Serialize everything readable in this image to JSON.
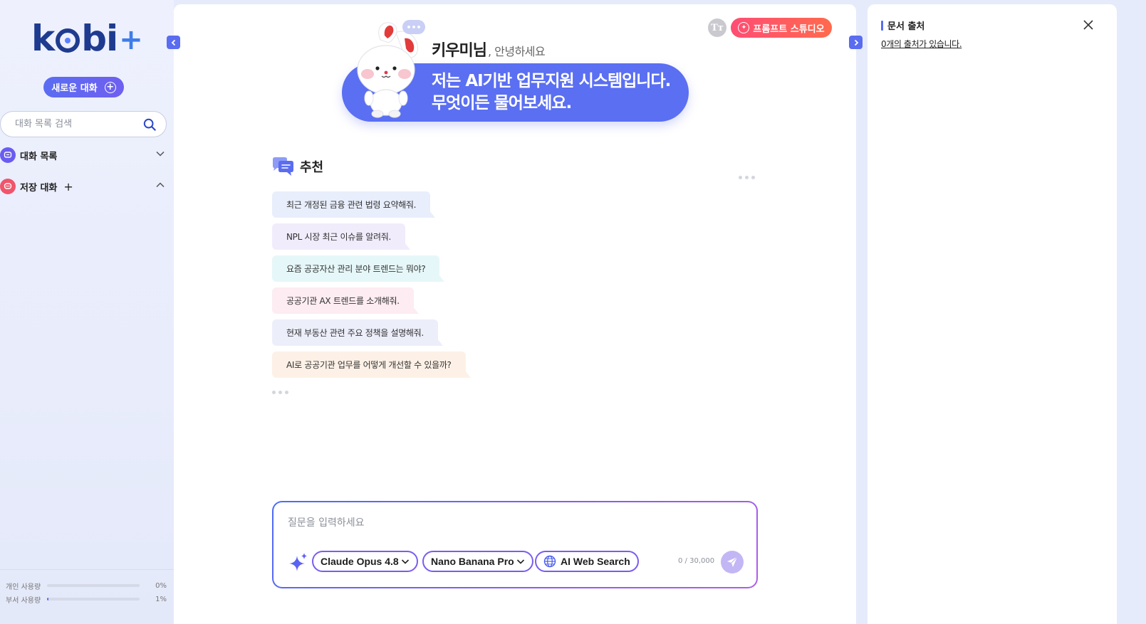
{
  "sidebar": {
    "logo": {
      "text_left": "k",
      "text_right": "bi",
      "plus": "+"
    },
    "new_chat_label": "새로운 대화",
    "search": {
      "placeholder": "대화 목록 검색",
      "value": ""
    },
    "sections": [
      {
        "label": "대화 목록",
        "icon": "chat-list-icon",
        "color": "#6a5cf0",
        "expanded": false
      },
      {
        "label": "저장 대화",
        "icon": "saved-chat-icon",
        "color": "#f0556b",
        "expanded": true,
        "add": "+"
      }
    ],
    "usage": [
      {
        "label": "개인 사용량",
        "percent_text": "0%",
        "fraction": 0.0
      },
      {
        "label": "부서 사용량",
        "percent_text": "1%",
        "fraction": 0.01
      }
    ]
  },
  "main": {
    "font_toggle_label": "Tт",
    "prompt_studio_label": "프롬프트 스튜디오",
    "greeting_name": "키우미님",
    "greeting_text": ", 안녕하세요",
    "hero_line1": "저는 AI기반 업무지원 시스템입니다.",
    "hero_line2": "무엇이든 물어보세요.",
    "typing_bubble": "•••",
    "recommend_title": "추천",
    "recommendations": [
      {
        "text": "최근 개정된 금융 관련 법령 요약해줘.",
        "bg": "#e8eefb",
        "tail": "#e8eefb"
      },
      {
        "text": "NPL 시장 최근 이슈를 알려줘.",
        "bg": "#f1ecfb",
        "tail": "#f1ecfb"
      },
      {
        "text": "요즘 공공자산 관리 분야 트렌드는 뭐야?",
        "bg": "#e6f7f9",
        "tail": "#e6f7f9"
      },
      {
        "text": "공공기관 AX 트렌드를 소개해줘.",
        "bg": "#fdecf2",
        "tail": "#fdecf2"
      },
      {
        "text": "현재 부동산 관련 주요 정책을 설명해줘.",
        "bg": "#eceefa",
        "tail": "#eceefa"
      },
      {
        "text": "AI로 공공기관 업무를 어떻게 개선할 수 있을까?",
        "bg": "#fdf1e7",
        "tail": "#fdf1e7"
      }
    ],
    "input": {
      "placeholder": "질문을 입력하세요",
      "value": "",
      "char_count": "0 / 30,000",
      "model_label": "Claude Opus 4.8",
      "image_model_label": "Nano Banana Pro",
      "web_search_label": "AI Web Search"
    }
  },
  "right_panel": {
    "title": "문서 출처",
    "sources_text": "0개의 출처가 있습니다."
  },
  "colors": {
    "accent": "#5a6cf0",
    "prompt_studio": "#ff5a68",
    "send_disabled": "#c3b6f5"
  }
}
